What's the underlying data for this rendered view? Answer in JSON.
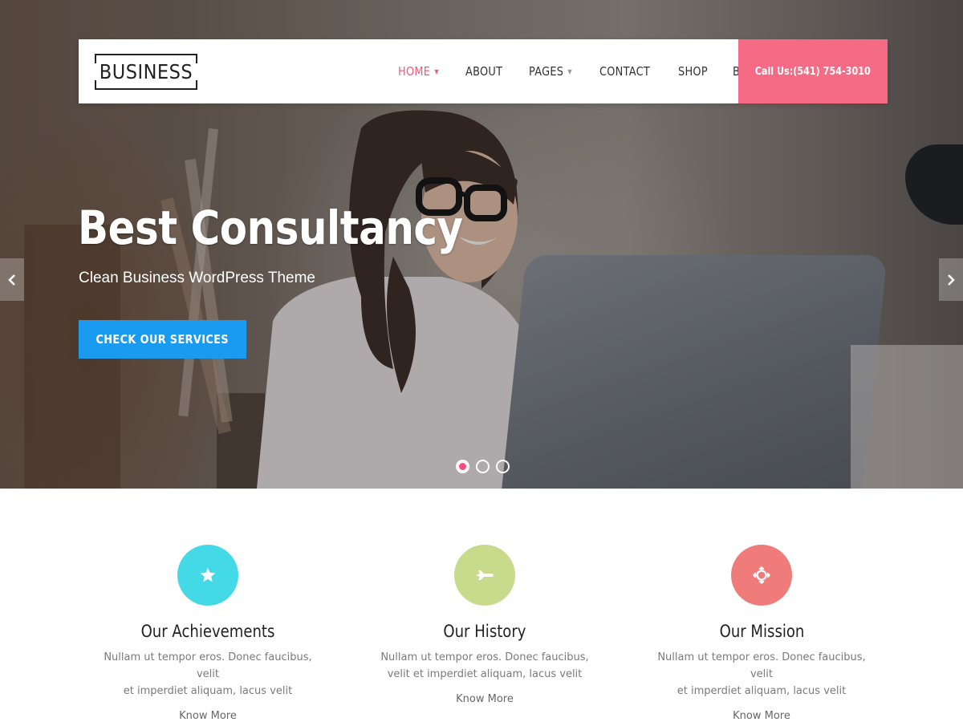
{
  "header": {
    "logo": "BUSINESS",
    "nav": [
      {
        "label": "HOME",
        "active": true,
        "has_dropdown": true
      },
      {
        "label": "ABOUT",
        "active": false,
        "has_dropdown": false
      },
      {
        "label": "PAGES",
        "active": false,
        "has_dropdown": true
      },
      {
        "label": "CONTACT",
        "active": false,
        "has_dropdown": false
      },
      {
        "label": "SHOP",
        "active": false,
        "has_dropdown": false
      },
      {
        "label": "BLOG",
        "active": false,
        "has_dropdown": false
      }
    ],
    "call_label": "Call Us:(541) 754-3010"
  },
  "hero": {
    "title": "Best Consultancy",
    "subtitle": "Clean Business WordPress Theme",
    "cta_label": "CHECK OUR SERVICES",
    "slides": 3,
    "active_slide": 1
  },
  "features": [
    {
      "icon": "star-icon",
      "color": "#44d9e6",
      "title": "Our Achievements",
      "desc_line1": "Nullam ut tempor eros. Donec faucibus, velit",
      "desc_line2": "et imperdiet aliquam, lacus velit",
      "link": "Know More"
    },
    {
      "icon": "airplane-icon",
      "color": "#c8da8c",
      "title": "Our History",
      "desc_line1": "Nullam ut tempor eros. Donec faucibus,",
      "desc_line2": "velit et imperdiet aliquam, lacus velit",
      "link": "Know More"
    },
    {
      "icon": "crosshair-icon",
      "color": "#f07b7b",
      "title": "Our Mission",
      "desc_line1": "Nullam ut tempor eros. Donec faucibus, velit",
      "desc_line2": "et imperdiet aliquam, lacus velit",
      "link": "Know More"
    }
  ],
  "colors": {
    "accent_pink": "#f56a84",
    "nav_active": "#ee5d78",
    "cta_blue": "#1a9bf0"
  }
}
